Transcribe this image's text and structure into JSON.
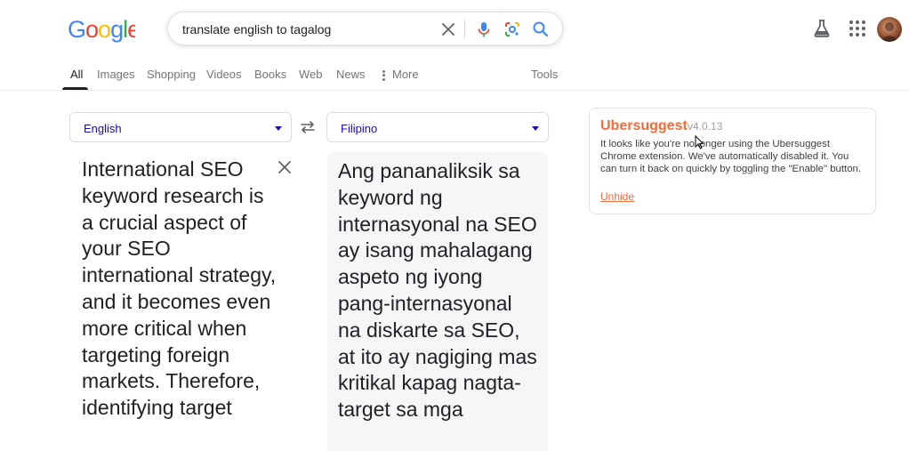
{
  "logo": {
    "letters": [
      "G",
      "o",
      "o",
      "g",
      "l",
      "e"
    ],
    "colors": [
      "#4285F4",
      "#EA4335",
      "#FBBC05",
      "#4285F4",
      "#34A853",
      "#EA4335"
    ]
  },
  "search": {
    "query": "translate english to tagalog"
  },
  "tabs": [
    {
      "label": "All",
      "active": true
    },
    {
      "label": "Images"
    },
    {
      "label": "Shopping"
    },
    {
      "label": "Videos"
    },
    {
      "label": "Books"
    },
    {
      "label": "Web"
    },
    {
      "label": "News"
    },
    {
      "label": "More"
    }
  ],
  "tools_label": "Tools",
  "translate": {
    "source_lang": "English",
    "target_lang": "Filipino",
    "source_text": "International SEO keyword research is a crucial aspect of your SEO international strategy, and it becomes even more critical when targeting foreign markets. Therefore, identifying target",
    "target_text": "Ang pananaliksik sa keyword ng internasyonal na SEO ay isang mahalagang aspeto ng iyong pang-internasyonal na diskarte sa SEO, at ito ay nagiging mas kritikal kapag nagta-target sa mga"
  },
  "ubersuggest": {
    "title": "Ubersuggest",
    "version": "v4.0.13",
    "message": "It looks like you're no longer using the Ubersuggest Chrome extension. We've automatically disabled it. You can turn it back on quickly by toggling the \"Enable\" button.",
    "link": "Unhide",
    "accent": "#f26b3a"
  },
  "icons": [
    "close-icon",
    "microphone-icon",
    "google-lens-icon",
    "search-icon",
    "labs-flask-icon",
    "apps-grid-icon",
    "swap-languages-icon",
    "clear-text-icon"
  ]
}
